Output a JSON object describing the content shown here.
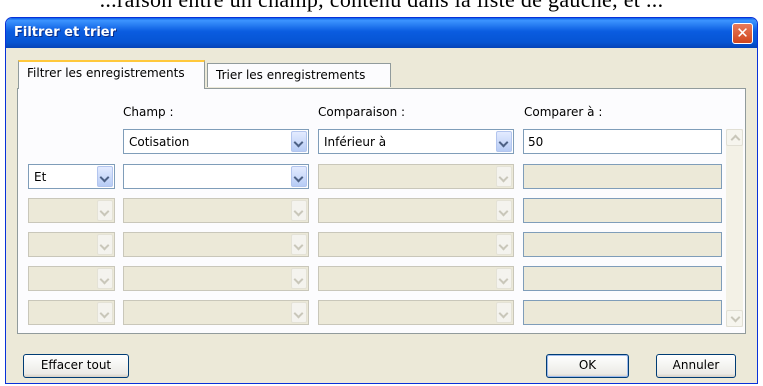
{
  "background_text": "...raison entre un champ, contenu dans la liste de gauche, et ...",
  "window": {
    "title": "Filtrer et trier",
    "close_glyph": "✕"
  },
  "tabs": [
    {
      "label": "Filtrer les enregistrements",
      "active": true
    },
    {
      "label": "Trier les enregistrements",
      "active": false
    }
  ],
  "columns": {
    "field": "Champ :",
    "comparison": "Comparaison :",
    "compare_to": "Comparer à :"
  },
  "rows": [
    {
      "conjunction": "",
      "field": "Cotisation",
      "comparison": "Inférieur à",
      "value": "50"
    },
    {
      "conjunction": "Et",
      "field": "",
      "comparison": "",
      "value": ""
    },
    {
      "conjunction": "",
      "field": "",
      "comparison": "",
      "value": ""
    },
    {
      "conjunction": "",
      "field": "",
      "comparison": "",
      "value": ""
    },
    {
      "conjunction": "",
      "field": "",
      "comparison": "",
      "value": ""
    },
    {
      "conjunction": "",
      "field": "",
      "comparison": "",
      "value": ""
    }
  ],
  "buttons": {
    "clear_all": "Effacer tout",
    "ok": "OK",
    "cancel": "Annuler"
  },
  "colors": {
    "titlebar": "#0a5ce0",
    "dialog_bg": "#ece9d8",
    "tab_highlight": "#ffc83c",
    "close": "#d0461d"
  },
  "icons": {
    "close": "close-icon",
    "dropdown": "chevron-down-icon",
    "scroll_up": "scroll-up-icon",
    "scroll_down": "scroll-down-icon"
  }
}
